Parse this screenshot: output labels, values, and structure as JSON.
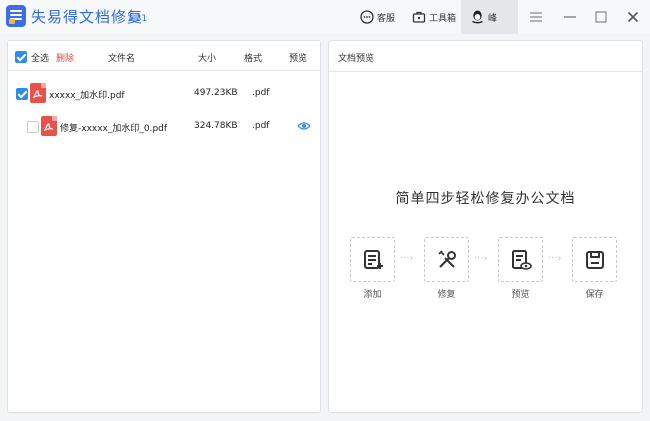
{
  "app": {
    "title": "失易得文档修复",
    "version": "1.31"
  },
  "toolbar": {
    "service_label": "客服",
    "toolbox_label": "工具箱",
    "user_name": "峰"
  },
  "list": {
    "header": {
      "select_all": "全选",
      "delete": "删除",
      "name": "文件名",
      "size": "大小",
      "format": "格式",
      "preview": "预览"
    },
    "rows": [
      {
        "name": "xxxxx_加水印.pdf",
        "size": "497.23KB",
        "format": ".pdf",
        "checked": true,
        "preview": false
      },
      {
        "name": "修复-xxxxx_加水印_0.pdf",
        "size": "324.78KB",
        "format": ".pdf",
        "checked": false,
        "preview": true
      }
    ]
  },
  "preview": {
    "title": "文档预览",
    "slogan": "简单四步轻松修复办公文档",
    "steps": [
      {
        "label": "添加",
        "icon": "add-document-icon"
      },
      {
        "label": "修复",
        "icon": "repair-tools-icon"
      },
      {
        "label": "预览",
        "icon": "preview-document-icon"
      },
      {
        "label": "保存",
        "icon": "save-icon"
      }
    ]
  },
  "colors": {
    "accent": "#2d6be4",
    "checkbox": "#2d8cf0",
    "delete": "#e54d42",
    "pdf": "#e8524a"
  }
}
